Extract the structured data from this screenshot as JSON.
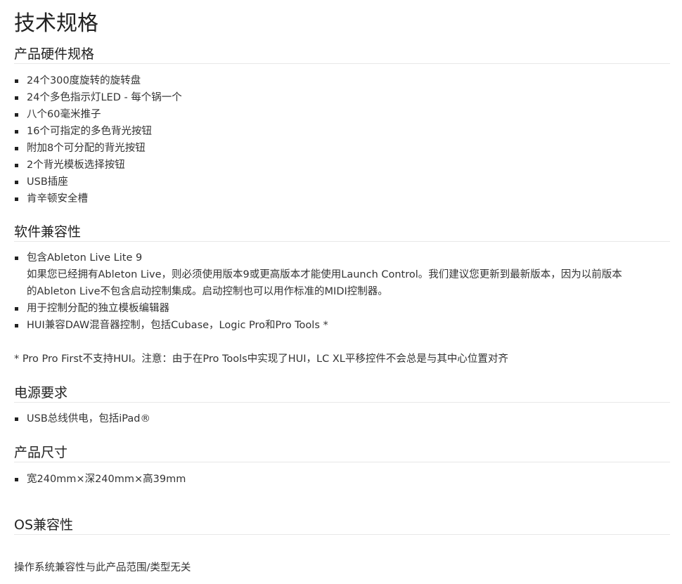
{
  "page_title": "技术规格",
  "sections": {
    "hardware": {
      "heading": "产品硬件规格",
      "items": [
        "24个300度旋转的旋转盘",
        "24个多色指示灯LED - 每个锅一个",
        "八个60毫米推子",
        "16个可指定的多色背光按钮",
        "附加8个可分配的背光按钮",
        "2个背光模板选择按钮",
        "USB插座",
        "肯辛顿安全槽"
      ]
    },
    "software": {
      "heading": "软件兼容性",
      "items": [
        {
          "title": "包含Ableton Live Lite 9",
          "detail_line1": "如果您已经拥有Ableton Live，则必须使用版本9或更高版本才能使用Launch Control。我们建议您更新到最新版本，因为以前版本",
          "detail_line2": "的Ableton Live不包含启动控制集成。启动控制也可以用作标准的MIDI控制器。"
        },
        {
          "title": "用于控制分配的独立模板编辑器"
        },
        {
          "title": "HUI兼容DAW混音器控制，包括Cubase，Logic Pro和Pro Tools *"
        }
      ],
      "footnote": "* Pro Pro First不支持HUI。注意：由于在Pro Tools中实现了HUI，LC XL平移控件不会总是与其中心位置对齐"
    },
    "power": {
      "heading": "电源要求",
      "items": [
        "USB总线供电，包括iPad®"
      ]
    },
    "dimensions": {
      "heading": "产品尺寸",
      "items": [
        "宽240mm×深240mm×高39mm"
      ]
    },
    "os": {
      "heading": "OS兼容性",
      "text": "操作系统兼容性与此产品范围/类型无关"
    }
  }
}
